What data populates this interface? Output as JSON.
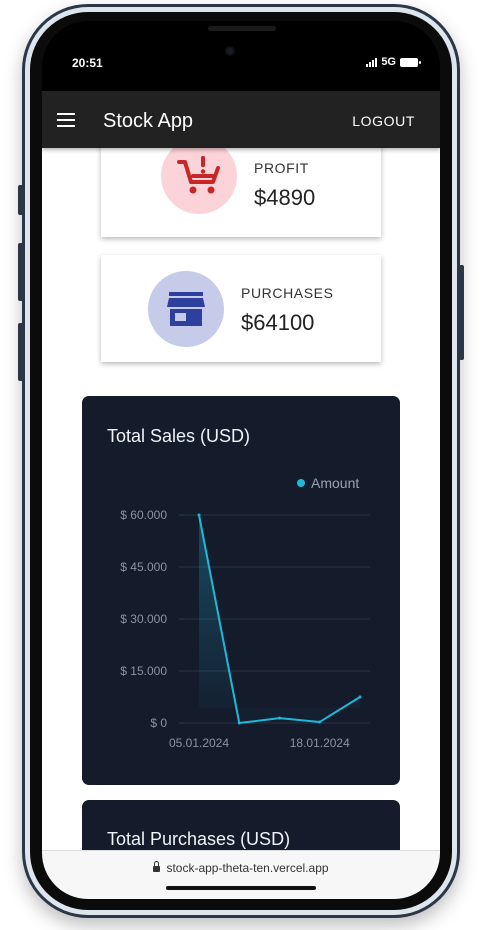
{
  "status_bar": {
    "time": "20:51",
    "network": "5G"
  },
  "app_bar": {
    "title": "Stock App",
    "logout_label": "LOGOUT"
  },
  "stats": [
    {
      "label": "PROFIT",
      "value": "$4890",
      "icon": "cart-icon",
      "icon_color": "#c62828",
      "bg_color": "#fcd3d8"
    },
    {
      "label": "PURCHASES",
      "value": "$64100",
      "icon": "store-icon",
      "icon_color": "#2f3f9e",
      "bg_color": "#c5cbe8"
    }
  ],
  "sales_chart": {
    "title": "Total Sales (USD)",
    "legend": "Amount",
    "line_color": "#1eb8d8"
  },
  "purchases_chart": {
    "title": "Total Purchases (USD)"
  },
  "chart_data": {
    "type": "area",
    "title": "Total Sales (USD)",
    "series": [
      {
        "name": "Amount",
        "values": [
          60000,
          0,
          1400,
          300,
          7500
        ]
      }
    ],
    "x_tick_labels": [
      "05.01.2024",
      "18.01.2024"
    ],
    "y_tick_labels": [
      "$ 0",
      "$ 15.000",
      "$ 30.000",
      "$ 45.000",
      "$ 60.000"
    ],
    "ylim": [
      0,
      60000
    ],
    "grid": true,
    "legend_position": "top-right"
  },
  "browser": {
    "url": "stock-app-theta-ten.vercel.app"
  }
}
